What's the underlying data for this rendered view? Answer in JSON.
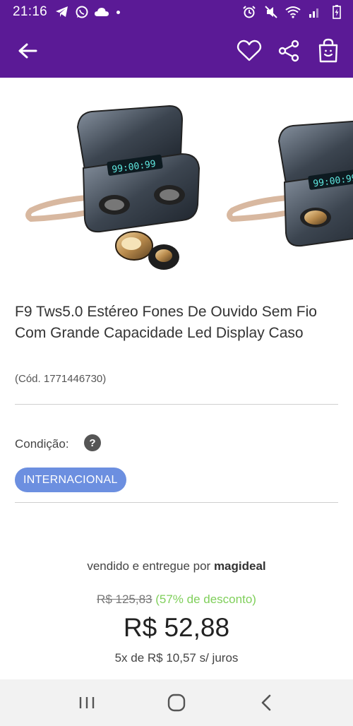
{
  "status_bar": {
    "time": "21:16",
    "left_icons": [
      "telegram-icon",
      "whatsapp-icon",
      "cloud-icon",
      "dot-icon"
    ],
    "right_icons": [
      "alarm-icon",
      "mute-icon",
      "wifi-icon",
      "signal-icon",
      "battery-icon"
    ]
  },
  "app_bar": {
    "icons": [
      "back-arrow-icon",
      "heart-icon",
      "share-icon",
      "shopping-bag-icon"
    ]
  },
  "product": {
    "title": "F9 Tws5.0 Estéreo Fones De Ouvido Sem Fio Com Grande Capacidade Led Display Caso",
    "code": "(Cód. 1771446730)",
    "display_text": "99:00:99",
    "condition_label": "Condição:",
    "condition_help": "?",
    "condition_badge": "INTERNACIONAL"
  },
  "pricing": {
    "seller_prefix": "vendido e entregue por",
    "seller_name": "magideal",
    "old_price": "R$ 125,83",
    "discount": "(57% de desconto)",
    "price": "R$ 52,88",
    "installments": "5x de R$ 10,57 s/ juros"
  },
  "colors": {
    "header": "#5b1a96",
    "badge": "#6c8fe0",
    "discount": "#7fcf5a"
  },
  "nav_bar": {
    "icons": [
      "recent-apps-icon",
      "home-icon",
      "back-icon"
    ]
  }
}
